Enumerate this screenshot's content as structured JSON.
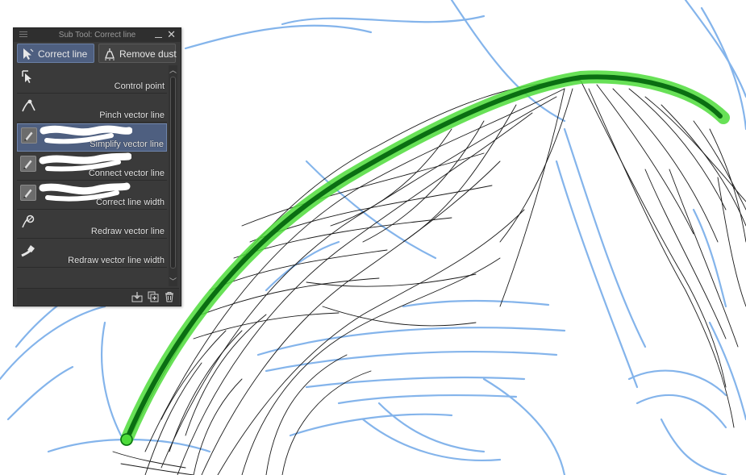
{
  "palette": {
    "title": "Sub Tool: Correct line",
    "tabs": [
      {
        "label": "Correct line",
        "icon": "arrow-cursor-icon",
        "active": true
      },
      {
        "label": "Remove dust",
        "icon": "dustpan-icon",
        "active": false
      }
    ],
    "items": [
      {
        "label": "Control point",
        "icon": "control-point-icon",
        "selected": false
      },
      {
        "label": "Pinch vector line",
        "icon": "pinch-vector-icon",
        "selected": false
      },
      {
        "label": "Simplify vector line",
        "icon": "brush-tool-icon",
        "selected": true
      },
      {
        "label": "Connect vector line",
        "icon": "brush-tool-icon",
        "selected": false
      },
      {
        "label": "Correct line width",
        "icon": "brush-tool-icon",
        "selected": false
      },
      {
        "label": "Redraw vector line",
        "icon": "redraw-vector-icon",
        "selected": false
      },
      {
        "label": "Redraw vector line width",
        "icon": "redraw-width-icon",
        "selected": false
      }
    ],
    "bottom_buttons": [
      "import-subtool-icon",
      "duplicate-subtool-icon",
      "delete-subtool-icon"
    ]
  },
  "canvas": {
    "sketch_color": "#6fa8e8",
    "lineart_color": "#1a1a1a",
    "highlight_color": "#4ddc3a",
    "stroke_color": "#0a6e12"
  }
}
